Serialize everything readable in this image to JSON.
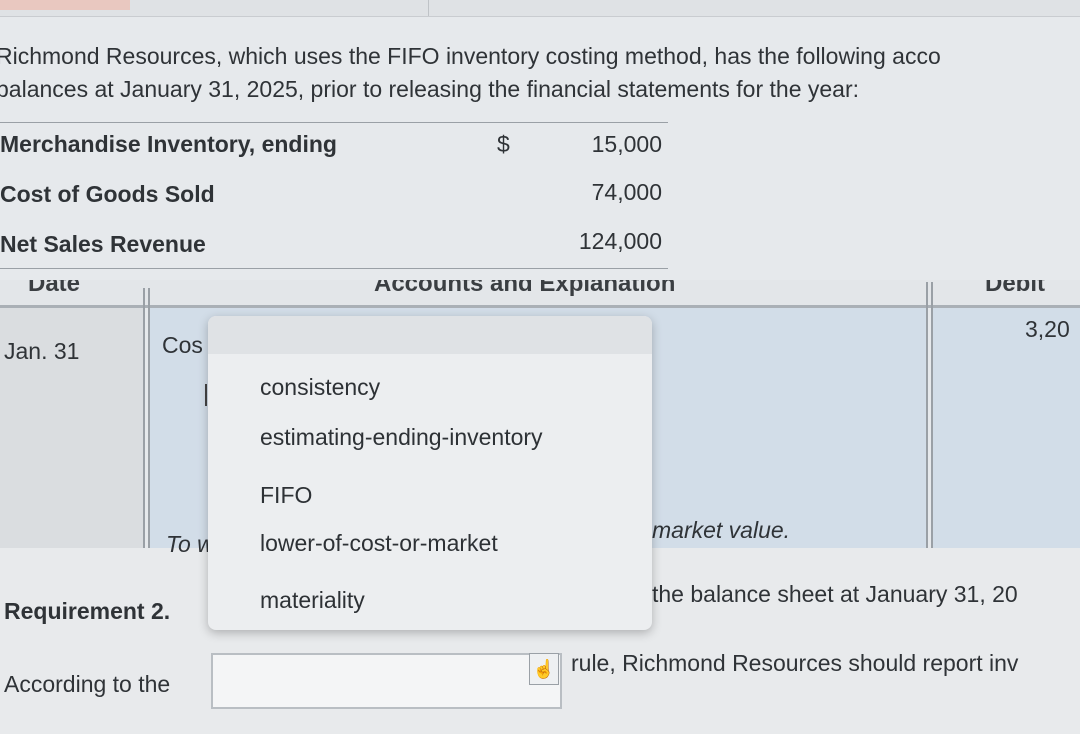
{
  "intro": {
    "line1": "Richmond Resources, which uses the FIFO inventory costing method, has the following acco",
    "line2": "balances at January 31, 2025, prior to releasing the financial statements for the year:"
  },
  "balances": [
    {
      "label": "Merchandise Inventory, ending",
      "dollar": "$",
      "amount": "15,000"
    },
    {
      "label": "Cost of Goods Sold",
      "dollar": "",
      "amount": "74,000"
    },
    {
      "label": "Net Sales Revenue",
      "dollar": "",
      "amount": "124,000"
    }
  ],
  "journal": {
    "headers": {
      "date": "Date",
      "accounts": "Accounts and Explanation",
      "debit": "Debit"
    },
    "row": {
      "date": "Jan. 31",
      "account_partial": "Cos",
      "debit_partial": "3,20"
    },
    "explanation_prefix": "To w",
    "explanation_suffix": "market value."
  },
  "dropdown": {
    "options": [
      "consistency",
      "estimating-ending-inventory",
      "FIFO",
      "lower-of-cost-or-market",
      "materiality"
    ]
  },
  "requirement2": {
    "label_partial": "Requirement 2.",
    "suffix": "the balance sheet at January 31, 20",
    "according_prefix": "According to the",
    "according_suffix": "rule, Richmond Resources should report inv"
  },
  "icons": {
    "hand": "hand-pointer-icon"
  }
}
